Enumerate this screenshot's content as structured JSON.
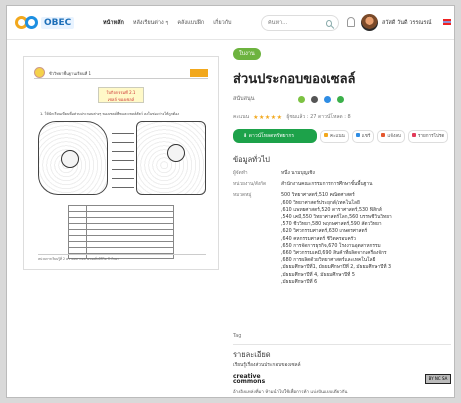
{
  "brand": {
    "logo_text": "OBEC"
  },
  "nav": {
    "items": [
      "หน้าหลัก",
      "หลังเรียนต่าง ๆ",
      "คลังแบบฝึก",
      "เกี่ยวกับ"
    ]
  },
  "search": {
    "placeholder": "ค้นหา..."
  },
  "user": {
    "name": "สวัสดี วันดี วรรณรณ์"
  },
  "document": {
    "header_text": "ชีววิทยาพื้นฐานเรียนที่ 1",
    "box_line1": "ใบกิจกรรมที่ 2.1",
    "box_line2": "เซลล์ ของเซลล์",
    "instruction": "1. ให้นักเรียนเขียนชื่อส่วนประกอบต่างๆ ของเซลล์พืชและเซลล์สัตว์ ลงในช่องว่างให้ถูกต้อง",
    "footer": "หน่วยการเรียนรู้ที่ 2 ความหลากหลายของสิ่งมีชีวิต ชีววิทยา"
  },
  "resource": {
    "tag": "ใบงาน",
    "title": "ส่วนประกอบของเซลล์",
    "support_label": "สนับสนุน",
    "rating_label": "คะแนน",
    "stars": "★★★★★",
    "stats": "ผู้ชมแล้ว : 27    ดาวน์โหลด : 8",
    "download_label": "ดาวน์โหลดทรัพยากร",
    "score_label": "คะแนน",
    "share_label": "แชร์",
    "report_label": "แจ้งลบ",
    "fav_label": "รายการโปรด"
  },
  "info": {
    "section_title": "ข้อมูลทั่วไป",
    "creator_key": "ผู้จัดทำ",
    "creator_value": "หนึ่ง นามบุญเชิง",
    "agency_key": "หน่วยงาน/สังกัด",
    "agency_value": "สำนักงานคณะกรรมการการศึกษาขั้นพื้นฐาน",
    "category_key": "หมวดหมู่",
    "categories": [
      "500 วิทยาศาสตร์,510 คณิตศาสตร์",
      ",600 วิทยาศาสตร์ประยุกต์/เทคโนโลยี",
      ",610 แพทยศาสตร์,520 ดาราศาสตร์,530 ฟิสิกส์",
      ",540 เคมี,550 วิทยาศาสตร์โลก,560 บรรพชีวินวิทยา",
      ",570 ชีววิทยา,580 พฤกษศาสตร์,590 สัตววิทยา",
      ",620 วิศวกรรมศาสตร์,630 เกษตรศาสตร์",
      ",640 คหกรรมศาสตร์ ชีวิตครอบครัว",
      ",650 การจัดการธุรกิจ,670 โรงงานอุตสาหกรรม",
      ",660 วิศวกรรมเคมี,690 สินค้าที่ผลิตจากเครื่องจักร",
      ",680 การผลิตด้วยวิทยาศาสตร์และเทคโนโลยี",
      ",มัธยมศึกษาปีที่1, มัธยมศึกษาปีที่ 2, มัธยมศึกษาปีที่ 3",
      ",มัธยมศึกษาปีที่ 4, มัธยมศึกษาปีที่ 5",
      ",มัธยมศึกษาปีที่ 6"
    ],
    "tag_label": "Tag"
  },
  "detail": {
    "title": "รายละเอียด",
    "text": "เรียนรู้เรื่องส่วนประกอบของเซลล์",
    "cc_logo_line1": "creative",
    "cc_logo_line2": "commons",
    "cc_badge": "BY NC SA",
    "cc_text": "อ้างอิงแหล่งที่มา ห้ามนำไปใช้เพื่อการค้า แบ่งปันแบบเดียวกัน"
  }
}
